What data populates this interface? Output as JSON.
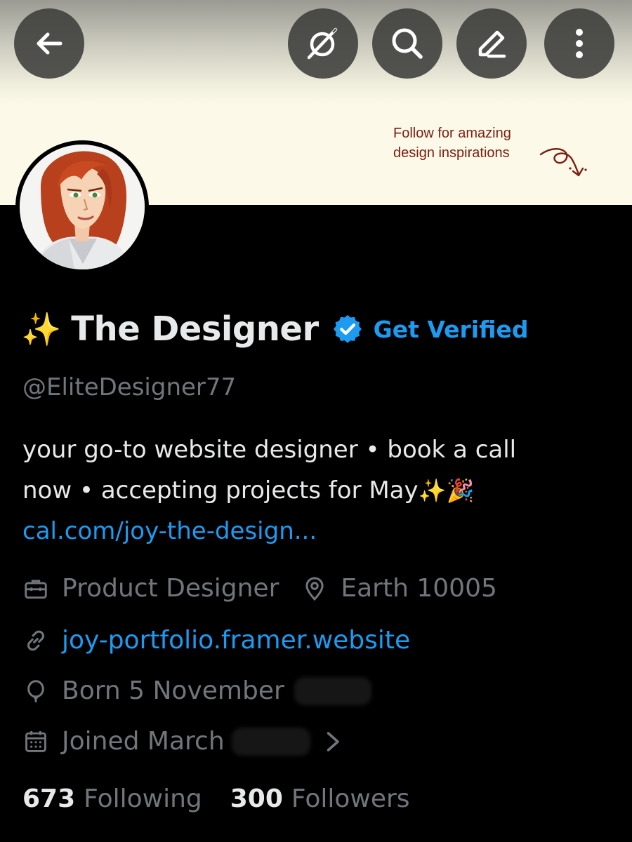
{
  "banner": {
    "note_line1": "Follow for amazing",
    "note_line2": "design inspirations"
  },
  "toolbar": {
    "back_icon": "arrow-left-icon",
    "grok_icon": "grok-icon",
    "search_icon": "search-icon",
    "edit_icon": "pencil-icon",
    "more_icon": "vertical-dots-icon"
  },
  "profile": {
    "name_prefix_emoji": "✨",
    "display_name": "The Designer",
    "get_verified_label": "Get Verified",
    "handle": "@EliteDesigner77",
    "bio_line1": "your go-to website designer  • book a call",
    "bio_line2": "now • accepting projects for May",
    "bio_line2_emoji": "✨🎉",
    "bio_link": "cal.com/joy-the-design...",
    "profession": "Product Designer",
    "location": "Earth 10005",
    "website": "joy-portfolio.framer.website",
    "born": "Born 5 November",
    "joined": "Joined March"
  },
  "stats": {
    "following_count": "673",
    "following_label": "Following",
    "followers_count": "300",
    "followers_label": "Followers"
  },
  "colors": {
    "background": "#000000",
    "accent": "#1d9bf0",
    "primary_text": "#e7e9ea",
    "secondary_text": "#71767b",
    "banner": "#fcf9e8",
    "banner_text": "#7a1f12"
  }
}
